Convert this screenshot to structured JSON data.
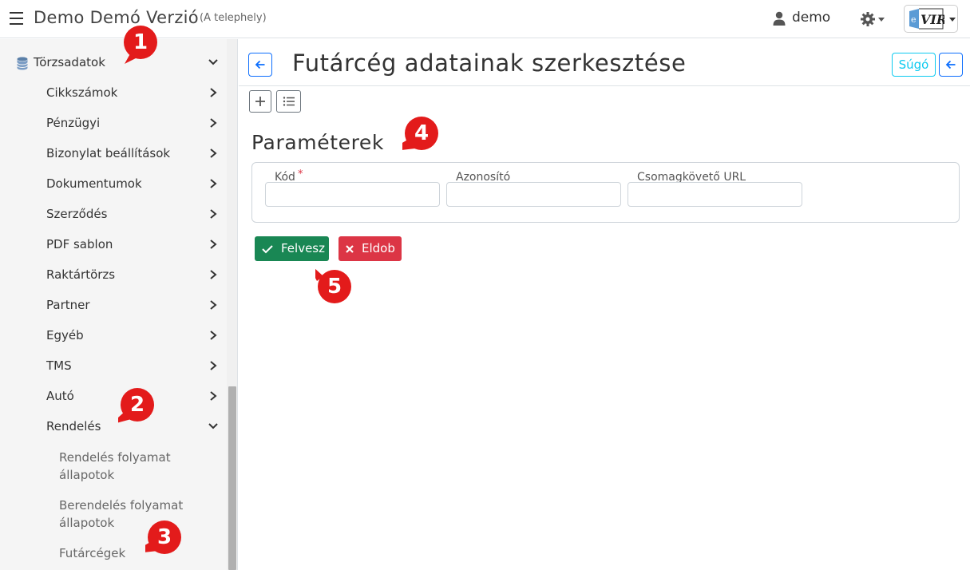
{
  "header": {
    "app_title": "Demo Demó Verzió",
    "location": "(A telephely)",
    "user": "demo",
    "icons": [
      "menu-icon",
      "user-icon",
      "gear-icon",
      "evir-logo",
      "caret-down-icon"
    ]
  },
  "sidebar": {
    "root": {
      "label": "Törzsadatok",
      "icon": "database-icon",
      "expanded": true
    },
    "items": [
      {
        "label": "Cikkszámok"
      },
      {
        "label": "Pénzügyi"
      },
      {
        "label": "Bizonylat beállítások"
      },
      {
        "label": "Dokumentumok"
      },
      {
        "label": "Szerződés"
      },
      {
        "label": "PDF sablon"
      },
      {
        "label": "Raktártörzs"
      },
      {
        "label": "Partner"
      },
      {
        "label": "Egyéb"
      },
      {
        "label": "TMS"
      },
      {
        "label": "Autó"
      },
      {
        "label": "Rendelés",
        "expanded": true
      }
    ],
    "subitems": [
      {
        "label": "Rendelés folyamat állapotok"
      },
      {
        "label": "Berendelés folyamat állapotok"
      },
      {
        "label": "Futárcégek"
      }
    ]
  },
  "main": {
    "title": "Futárcég adatainak szerkesztése",
    "help_label": "Súgó",
    "section_title": "Paraméterek",
    "fields": [
      {
        "label": "Kód",
        "required": "*",
        "value": ""
      },
      {
        "label": "Azonosító",
        "value": ""
      },
      {
        "label": "Csomagkövető URL",
        "value": ""
      }
    ],
    "save_label": "Felvesz",
    "discard_label": "Eldob"
  },
  "annotations": [
    "1",
    "2",
    "3",
    "4",
    "5"
  ],
  "colors": {
    "primary": "#0d6efd",
    "info": "#0dcaf0",
    "success": "#198754",
    "danger": "#dc3545",
    "marker": "#e31b1b"
  }
}
